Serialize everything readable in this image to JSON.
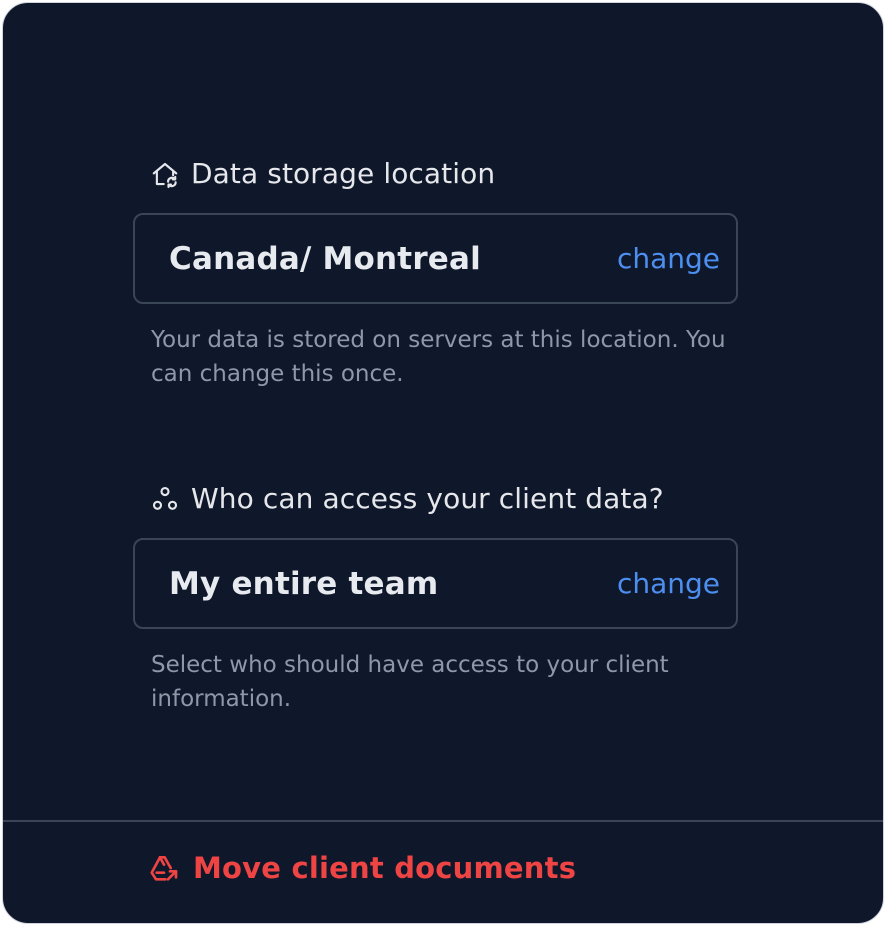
{
  "storage": {
    "heading": "Data storage location",
    "icon": "home-sync-icon",
    "value": "Canada/ Montreal",
    "change_label": "change",
    "helper": "Your data is stored on servers at this location. You can change this once."
  },
  "access": {
    "heading": "Who can access your client data?",
    "icon": "team-nodes-icon",
    "value": "My entire team",
    "change_label": "change",
    "helper": "Select who should have access to your client information."
  },
  "footer": {
    "action_label": "Move client documents",
    "icon": "move-documents-icon"
  },
  "colors": {
    "background": "#0f172a",
    "accent_link": "#4d8ff0",
    "danger": "#ef4444",
    "border": "#3a4556"
  }
}
